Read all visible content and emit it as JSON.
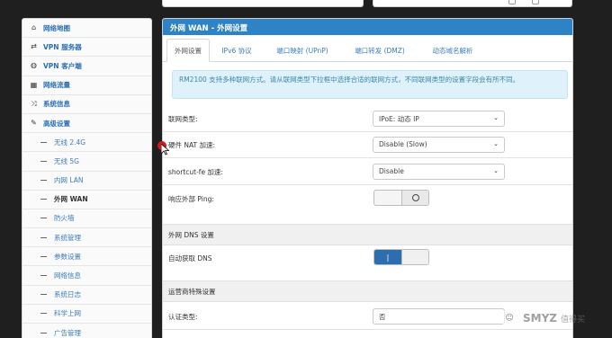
{
  "sidebar": {
    "items": [
      {
        "label": "网络地图",
        "icon": "home-icon",
        "glyph": "⌂"
      },
      {
        "label": "VPN 服务器",
        "icon": "retweet-icon",
        "glyph": "⇄"
      },
      {
        "label": "VPN 客户端",
        "icon": "globe-icon",
        "glyph": "◍"
      },
      {
        "label": "网络流量",
        "icon": "chart-icon",
        "glyph": "▦"
      },
      {
        "label": "系统信息",
        "icon": "shuffle-icon",
        "glyph": "⤨"
      },
      {
        "label": "高级设置",
        "icon": "wrench-icon",
        "glyph": "✎"
      }
    ],
    "subitems": [
      "无线 2.4G",
      "无线 5G",
      "内网 LAN",
      "外网 WAN",
      "防火墙",
      "系统管理",
      "参数设置",
      "网络信息",
      "系统日志",
      "科学上网",
      "广告管理"
    ],
    "active_subitem": "外网 WAN"
  },
  "panel": {
    "title": "外网 WAN - 外网设置",
    "tabs": [
      "外网设置",
      "IPv6 协议",
      "端口映射 (UPnP)",
      "端口转发 (DMZ)",
      "动态域名解析"
    ],
    "active_tab": "外网设置",
    "info_text": "RM2100 支持多种联网方式。请从联网类型下拉框中选择合适的联网方式，不同联网类型的设置字段会有所不同。"
  },
  "settings": {
    "wan_type_label": "联网类型:",
    "wan_type_value": "IPoE: 动态 IP",
    "hw_nat_label": "硬件 NAT 加速:",
    "hw_nat_value": "Disable (Slow)",
    "shortcut_label": "shortcut-fe 加速:",
    "shortcut_value": "Disable",
    "ping_label": "响应外部 Ping:",
    "ping_state": "off"
  },
  "dns": {
    "section_title": "外网 DNS 设置",
    "auto_label": "自动获取 DNS",
    "auto_state": "on"
  },
  "isp": {
    "section_title": "运营商特殊设置",
    "auth_label": "认证类型:",
    "auth_value": "否"
  },
  "watermark": {
    "text": "SMYZ",
    "sub": "值得买"
  }
}
